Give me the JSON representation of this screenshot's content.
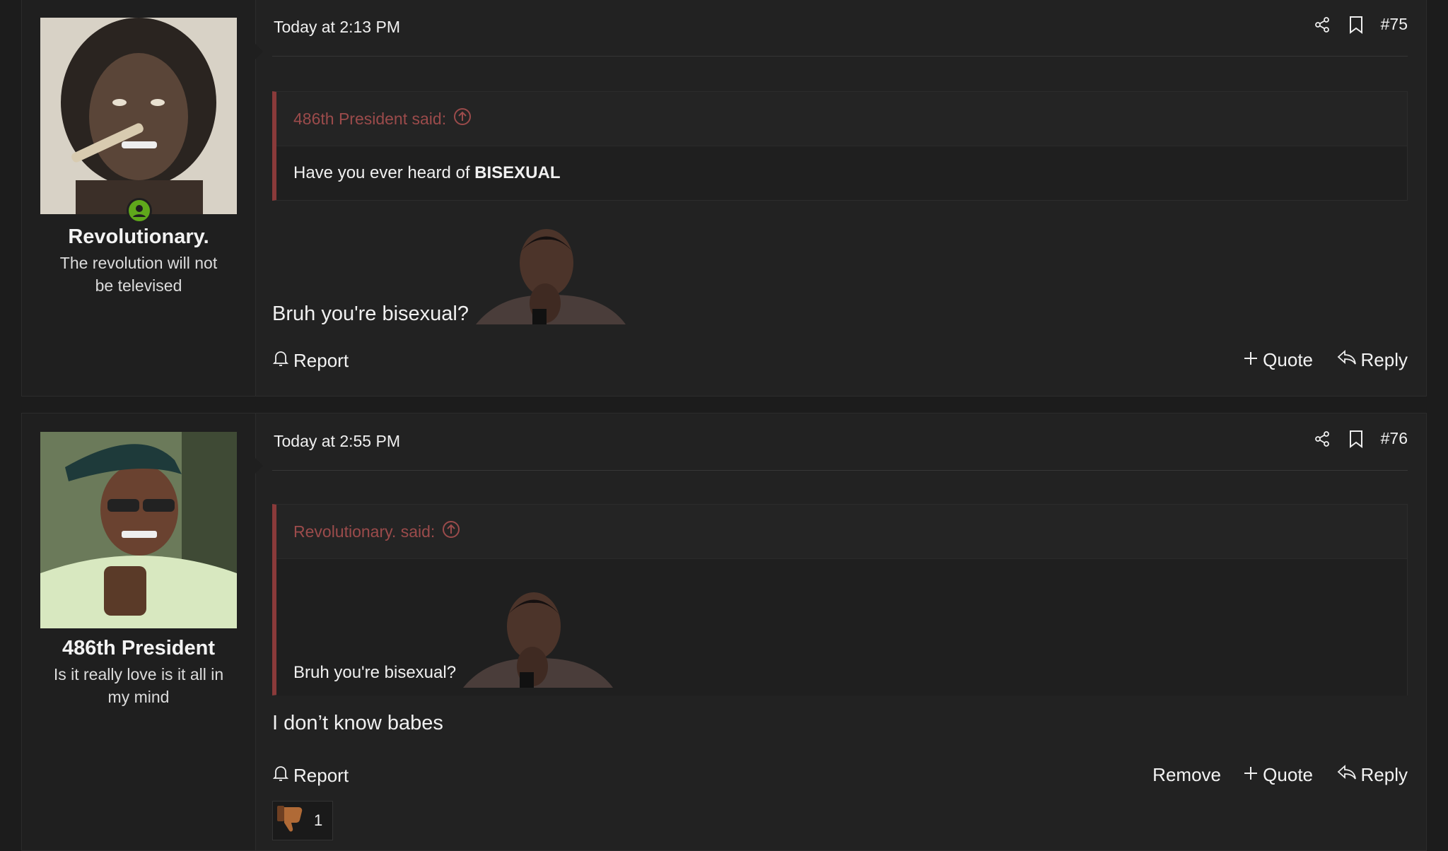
{
  "posts": [
    {
      "username": "Revolutionary.",
      "user_title": "The revolution will not be televised",
      "time": "Today at 2:13 PM",
      "number": "#75",
      "quote": {
        "author": "486th President said:",
        "text_plain": "Have you ever heard of ",
        "text_bold": "BISEXUAL"
      },
      "message": "Bruh you're bisexual?",
      "actions": {
        "report": "Report",
        "quote": "Quote",
        "reply": "Reply"
      }
    },
    {
      "username": "486th President",
      "user_title": "Is it really love is it all in my mind",
      "time": "Today at 2:55 PM",
      "number": "#76",
      "quote": {
        "author": "Revolutionary. said:",
        "text": "Bruh you're bisexual?"
      },
      "message": "I don’t know babes",
      "actions": {
        "report": "Report",
        "remove": "Remove",
        "quote": "Quote",
        "reply": "Reply"
      },
      "reaction": {
        "icon": "thumbs-down-icon",
        "count": "1"
      }
    }
  ],
  "colors": {
    "accent_quote": "#8a3a3a",
    "online": "#5fa81b"
  }
}
